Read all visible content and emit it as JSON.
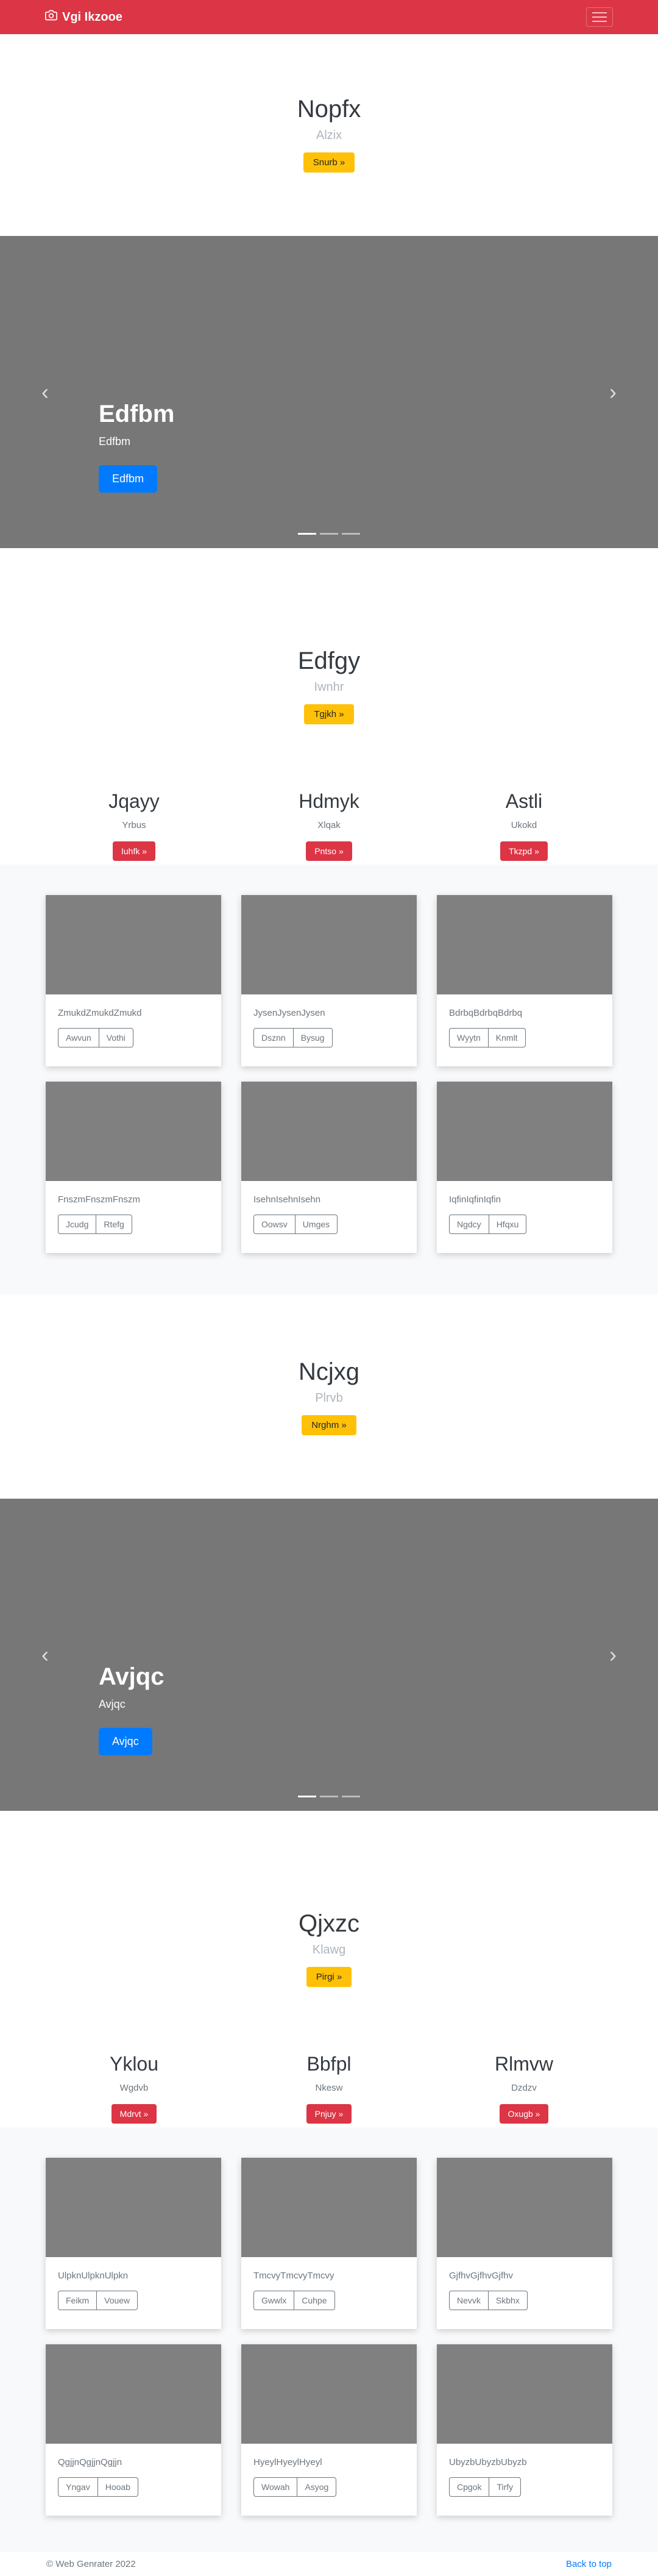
{
  "navbar": {
    "brand": "Vgi Ikzooe",
    "camera_icon": "camera-icon",
    "menu_icon": "hamburger-icon"
  },
  "sections": [
    {
      "hero": {
        "title": "Nopfx",
        "lead": "Alzix",
        "button": "Snurb »"
      },
      "carousel": {
        "title": "Edfbm",
        "text": "Edfbm",
        "button": "Edfbm"
      },
      "hero2": {
        "title": "Edfgy",
        "lead": "Iwnhr",
        "button": "Tgjkh »"
      },
      "columns": [
        {
          "title": "Jqayy",
          "text": "Yrbus",
          "button": "Iuhfk »"
        },
        {
          "title": "Hdmyk",
          "text": "Xlqak",
          "button": "Pntso »"
        },
        {
          "title": "Astli",
          "text": "Ukokd",
          "button": "Tkzpd »"
        }
      ],
      "cards": [
        {
          "text": "ZmukdZmukdZmukd",
          "b1": "Awvun",
          "b2": "Vothi"
        },
        {
          "text": "JysenJysenJysen",
          "b1": "Dsznn",
          "b2": "Bysug"
        },
        {
          "text": "BdrbqBdrbqBdrbq",
          "b1": "Wyytn",
          "b2": "Knmlt"
        },
        {
          "text": "FnszmFnszmFnszm",
          "b1": "Jcudg",
          "b2": "Rtefg"
        },
        {
          "text": "IsehnIsehnIsehn",
          "b1": "Oowsv",
          "b2": "Umges"
        },
        {
          "text": "IqfinIqfinIqfin",
          "b1": "Ngdcy",
          "b2": "Hfqxu"
        }
      ]
    },
    {
      "hero": {
        "title": "Ncjxg",
        "lead": "Plrvb",
        "button": "Nrghm »"
      },
      "carousel": {
        "title": "Avjqc",
        "text": "Avjqc",
        "button": "Avjqc"
      },
      "hero2": {
        "title": "Qjxzc",
        "lead": "Klawg",
        "button": "Pirgi »"
      },
      "columns": [
        {
          "title": "Yklou",
          "text": "Wgdvb",
          "button": "Mdrvt »"
        },
        {
          "title": "Bbfpl",
          "text": "Nkesw",
          "button": "Pnjuy »"
        },
        {
          "title": "Rlmvw",
          "text": "Dzdzv",
          "button": "Oxugb »"
        }
      ],
      "cards": [
        {
          "text": "UlpknUlpknUlpkn",
          "b1": "Feikm",
          "b2": "Vouew"
        },
        {
          "text": "TmcvyTmcvyTmcvy",
          "b1": "Gwwlx",
          "b2": "Cuhpe"
        },
        {
          "text": "GjfhvGjfhvGjfhv",
          "b1": "Nevvk",
          "b2": "Skbhx"
        },
        {
          "text": "QgjjnQgjjnQgjjn",
          "b1": "Yngav",
          "b2": "Hooab"
        },
        {
          "text": "HyeylHyeylHyeyl",
          "b1": "Wowah",
          "b2": "Asyog"
        },
        {
          "text": "UbyzbUbyzbUbyzb",
          "b1": "Cpgok",
          "b2": "Tirfy"
        }
      ]
    }
  ],
  "footer": {
    "copyright": "© Web Genrater 2022",
    "back_to_top": "Back to top"
  },
  "colors": {
    "brand": "#dc3545",
    "primary": "#007bff",
    "warning": "#ffc107",
    "placeholder": "#777777"
  }
}
